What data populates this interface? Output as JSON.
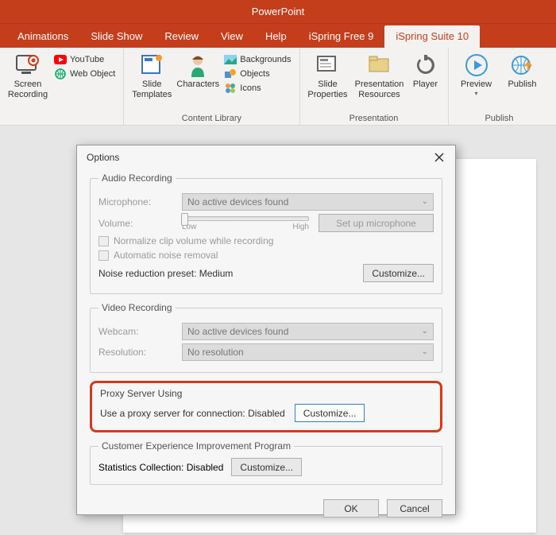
{
  "app_title": "PowerPoint",
  "tabs": {
    "animations": "Animations",
    "slideshow": "Slide Show",
    "review": "Review",
    "view": "View",
    "help": "Help",
    "ispring_free": "iSpring Free 9",
    "ispring_suite": "iSpring Suite 10"
  },
  "ribbon": {
    "screen_recording": "Screen\nRecording",
    "youtube": "YouTube",
    "web_object": "Web Object",
    "slide_templates": "Slide\nTemplates",
    "characters": "Characters",
    "backgrounds": "Backgrounds",
    "objects": "Objects",
    "icons": "Icons",
    "content_library": "Content Library",
    "slide_properties": "Slide\nProperties",
    "presentation_resources": "Presentation\nResources",
    "player": "Player",
    "presentation_group": "Presentation",
    "preview": "Preview",
    "publish_btn": "Publish",
    "publish_group": "Publish"
  },
  "dialog": {
    "title": "Options",
    "audio": {
      "legend": "Audio Recording",
      "mic_label": "Microphone:",
      "mic_value": "No active devices found",
      "vol_label": "Volume:",
      "slider_low": "Low",
      "slider_high": "High",
      "setup_btn": "Set up microphone",
      "normalize": "Normalize clip volume while recording",
      "auto_noise": "Automatic noise removal",
      "noise_preset": "Noise reduction preset: Medium",
      "customize": "Customize..."
    },
    "video": {
      "legend": "Video Recording",
      "webcam_label": "Webcam:",
      "webcam_value": "No active devices found",
      "res_label": "Resolution:",
      "res_value": "No resolution"
    },
    "proxy": {
      "legend": "Proxy Server Using",
      "text": "Use a proxy server for connection: Disabled",
      "customize": "Customize..."
    },
    "cep": {
      "legend": "Customer Experience Improvement Program",
      "text": "Statistics Collection: Disabled",
      "customize": "Customize..."
    },
    "ok": "OK",
    "cancel": "Cancel"
  }
}
